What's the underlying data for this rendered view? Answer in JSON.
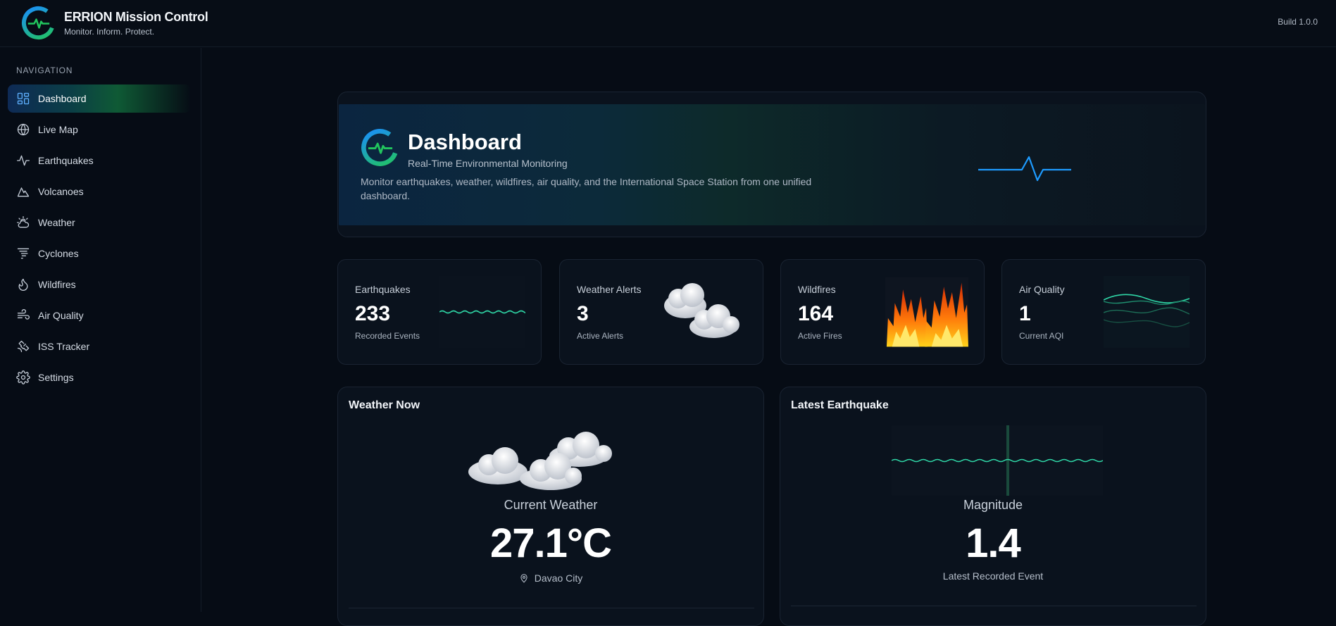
{
  "app": {
    "title": "ERRION Mission Control",
    "tagline": "Monitor. Inform. Protect.",
    "build": "Build 1.0.0"
  },
  "sidebar": {
    "heading": "NAVIGATION",
    "items": [
      {
        "label": "Dashboard",
        "icon": "dashboard-icon",
        "active": true
      },
      {
        "label": "Live Map",
        "icon": "globe-icon"
      },
      {
        "label": "Earthquakes",
        "icon": "activity-icon"
      },
      {
        "label": "Volcanoes",
        "icon": "mountain-icon"
      },
      {
        "label": "Weather",
        "icon": "cloud-sun-icon"
      },
      {
        "label": "Cyclones",
        "icon": "tornado-icon"
      },
      {
        "label": "Wildfires",
        "icon": "flame-icon"
      },
      {
        "label": "Air Quality",
        "icon": "wind-icon"
      },
      {
        "label": "ISS Tracker",
        "icon": "satellite-icon"
      },
      {
        "label": "Settings",
        "icon": "gear-icon"
      }
    ]
  },
  "hero": {
    "title": "Dashboard",
    "subtitle": "Real-Time Environmental Monitoring",
    "description": "Monitor earthquakes, weather, wildfires, air quality, and the International Space Station from one unified dashboard."
  },
  "stats": [
    {
      "label": "Earthquakes",
      "value": "233",
      "sub": "Recorded Events",
      "art": "wave-icon"
    },
    {
      "label": "Weather Alerts",
      "value": "3",
      "sub": "Active Alerts",
      "art": "clouds-icon"
    },
    {
      "label": "Wildfires",
      "value": "164",
      "sub": "Active Fires",
      "art": "fire-icon"
    },
    {
      "label": "Air Quality",
      "value": "1",
      "sub": "Current AQI",
      "art": "air-waves-icon"
    }
  ],
  "weather_panel": {
    "title": "Weather Now",
    "caption": "Current Weather",
    "temperature": "27.1°C",
    "location": "Davao City"
  },
  "quake_panel": {
    "title": "Latest Earthquake",
    "caption": "Magnitude",
    "magnitude": "1.4",
    "foot": "Latest Recorded Event"
  },
  "colors": {
    "background": "#060c15",
    "accent_blue": "#1e9bff",
    "accent_green": "#22c55e",
    "wave_teal": "#2fd6a6"
  }
}
